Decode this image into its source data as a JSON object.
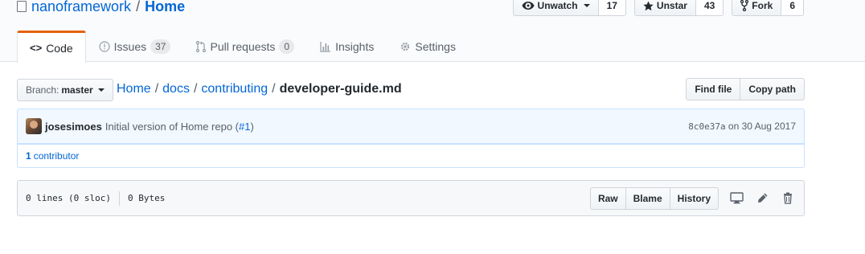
{
  "repo": {
    "owner": "nanoframework",
    "separator": "/",
    "name": "Home"
  },
  "actions": {
    "watch": {
      "label": "Unwatch",
      "count": "17",
      "icon": "eye-icon"
    },
    "star": {
      "label": "Unstar",
      "count": "43",
      "icon": "star-icon"
    },
    "fork": {
      "label": "Fork",
      "count": "6",
      "icon": "repo-forked-icon"
    }
  },
  "tabs": [
    {
      "label": "Code",
      "icon": "code-icon",
      "selected": true
    },
    {
      "label": "Issues",
      "icon": "issue-opened-icon",
      "count": "37"
    },
    {
      "label": "Pull requests",
      "icon": "git-pull-request-icon",
      "count": "0"
    },
    {
      "label": "Insights",
      "icon": "graph-icon"
    },
    {
      "label": "Settings",
      "icon": "gear-icon"
    }
  ],
  "branch": {
    "label": "Branch:",
    "value": "master"
  },
  "breadcrumb": {
    "root": "Home",
    "parts": [
      "docs",
      "contributing"
    ],
    "file": "developer-guide.md",
    "sep": "/"
  },
  "file_nav": {
    "find_file": "Find file",
    "copy_path": "Copy path"
  },
  "commit": {
    "author": "josesimoes",
    "message": "Initial version of Home repo (",
    "issue": "#1",
    "message_end": ")",
    "sha": "8c0e37a",
    "date_text": "on 30 Aug 2017"
  },
  "contributors": {
    "count": "1",
    "label": "contributor"
  },
  "file": {
    "lines": "0 lines (0 sloc)",
    "size": "0 Bytes",
    "raw": "Raw",
    "blame": "Blame",
    "history": "History"
  },
  "colors": {
    "link": "#0366d6",
    "tab_accent": "#e36209",
    "commit_bg": "#f1f8ff"
  }
}
